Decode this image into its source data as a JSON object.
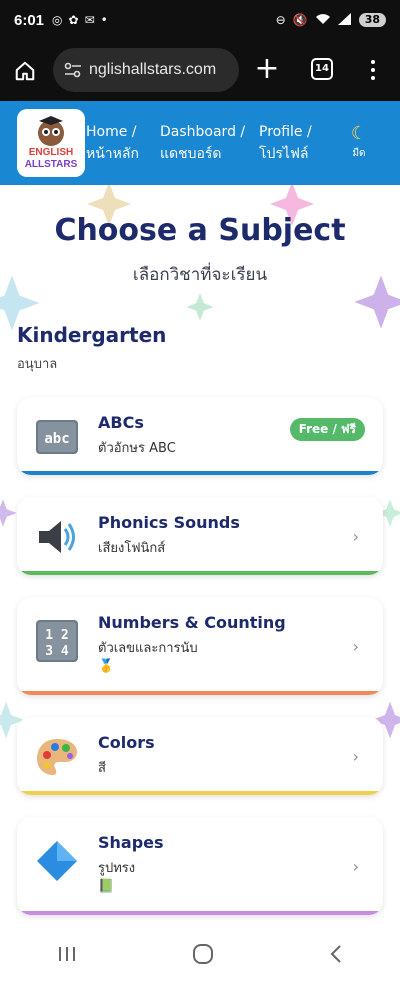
{
  "status_bar": {
    "time": "6:01",
    "battery": "38"
  },
  "browser": {
    "url": "nglishallstars.com",
    "tab_count": "14"
  },
  "site_nav": {
    "logo_top": "ENGLISH",
    "logo_bottom": "ALLSTARS",
    "links": [
      {
        "en": "Home /",
        "th": "หน้าหลัก"
      },
      {
        "en": "Dashboard /",
        "th": "แดชบอร์ด"
      },
      {
        "en": "Profile /",
        "th": "โปรไฟล์"
      }
    ],
    "dark_label": "มืด"
  },
  "page": {
    "title": "Choose a Subject",
    "subtitle": "เลือกวิชาที่จะเรียน"
  },
  "section": {
    "title": "Kindergarten",
    "subtitle": "อนุบาล"
  },
  "subjects": [
    {
      "name": "ABCs",
      "thai": "ตัวอักษร ABC",
      "badge": "Free / ฟรี",
      "icon": "abc-icon",
      "bar_color": "#1f82c9"
    },
    {
      "name": "Phonics Sounds",
      "thai": "เสียงโฟนิกส์",
      "icon": "speaker-icon",
      "bar_color": "#5cb85c"
    },
    {
      "name": "Numbers & Counting",
      "thai": "ตัวเลขและการนับ",
      "extra": "🥇",
      "icon": "numbers-icon",
      "bar_color": "#f08a5d"
    },
    {
      "name": "Colors",
      "thai": "สี",
      "icon": "palette-icon",
      "bar_color": "#f2cf4a"
    },
    {
      "name": "Shapes",
      "thai": "รูปทรง",
      "extra": "📗",
      "icon": "diamond-icon",
      "bar_color": "#c98ce0"
    }
  ],
  "colors": {
    "nav_blue": "#1a87d3",
    "title_navy": "#1d2a6b",
    "free_badge": "#55b96a"
  }
}
